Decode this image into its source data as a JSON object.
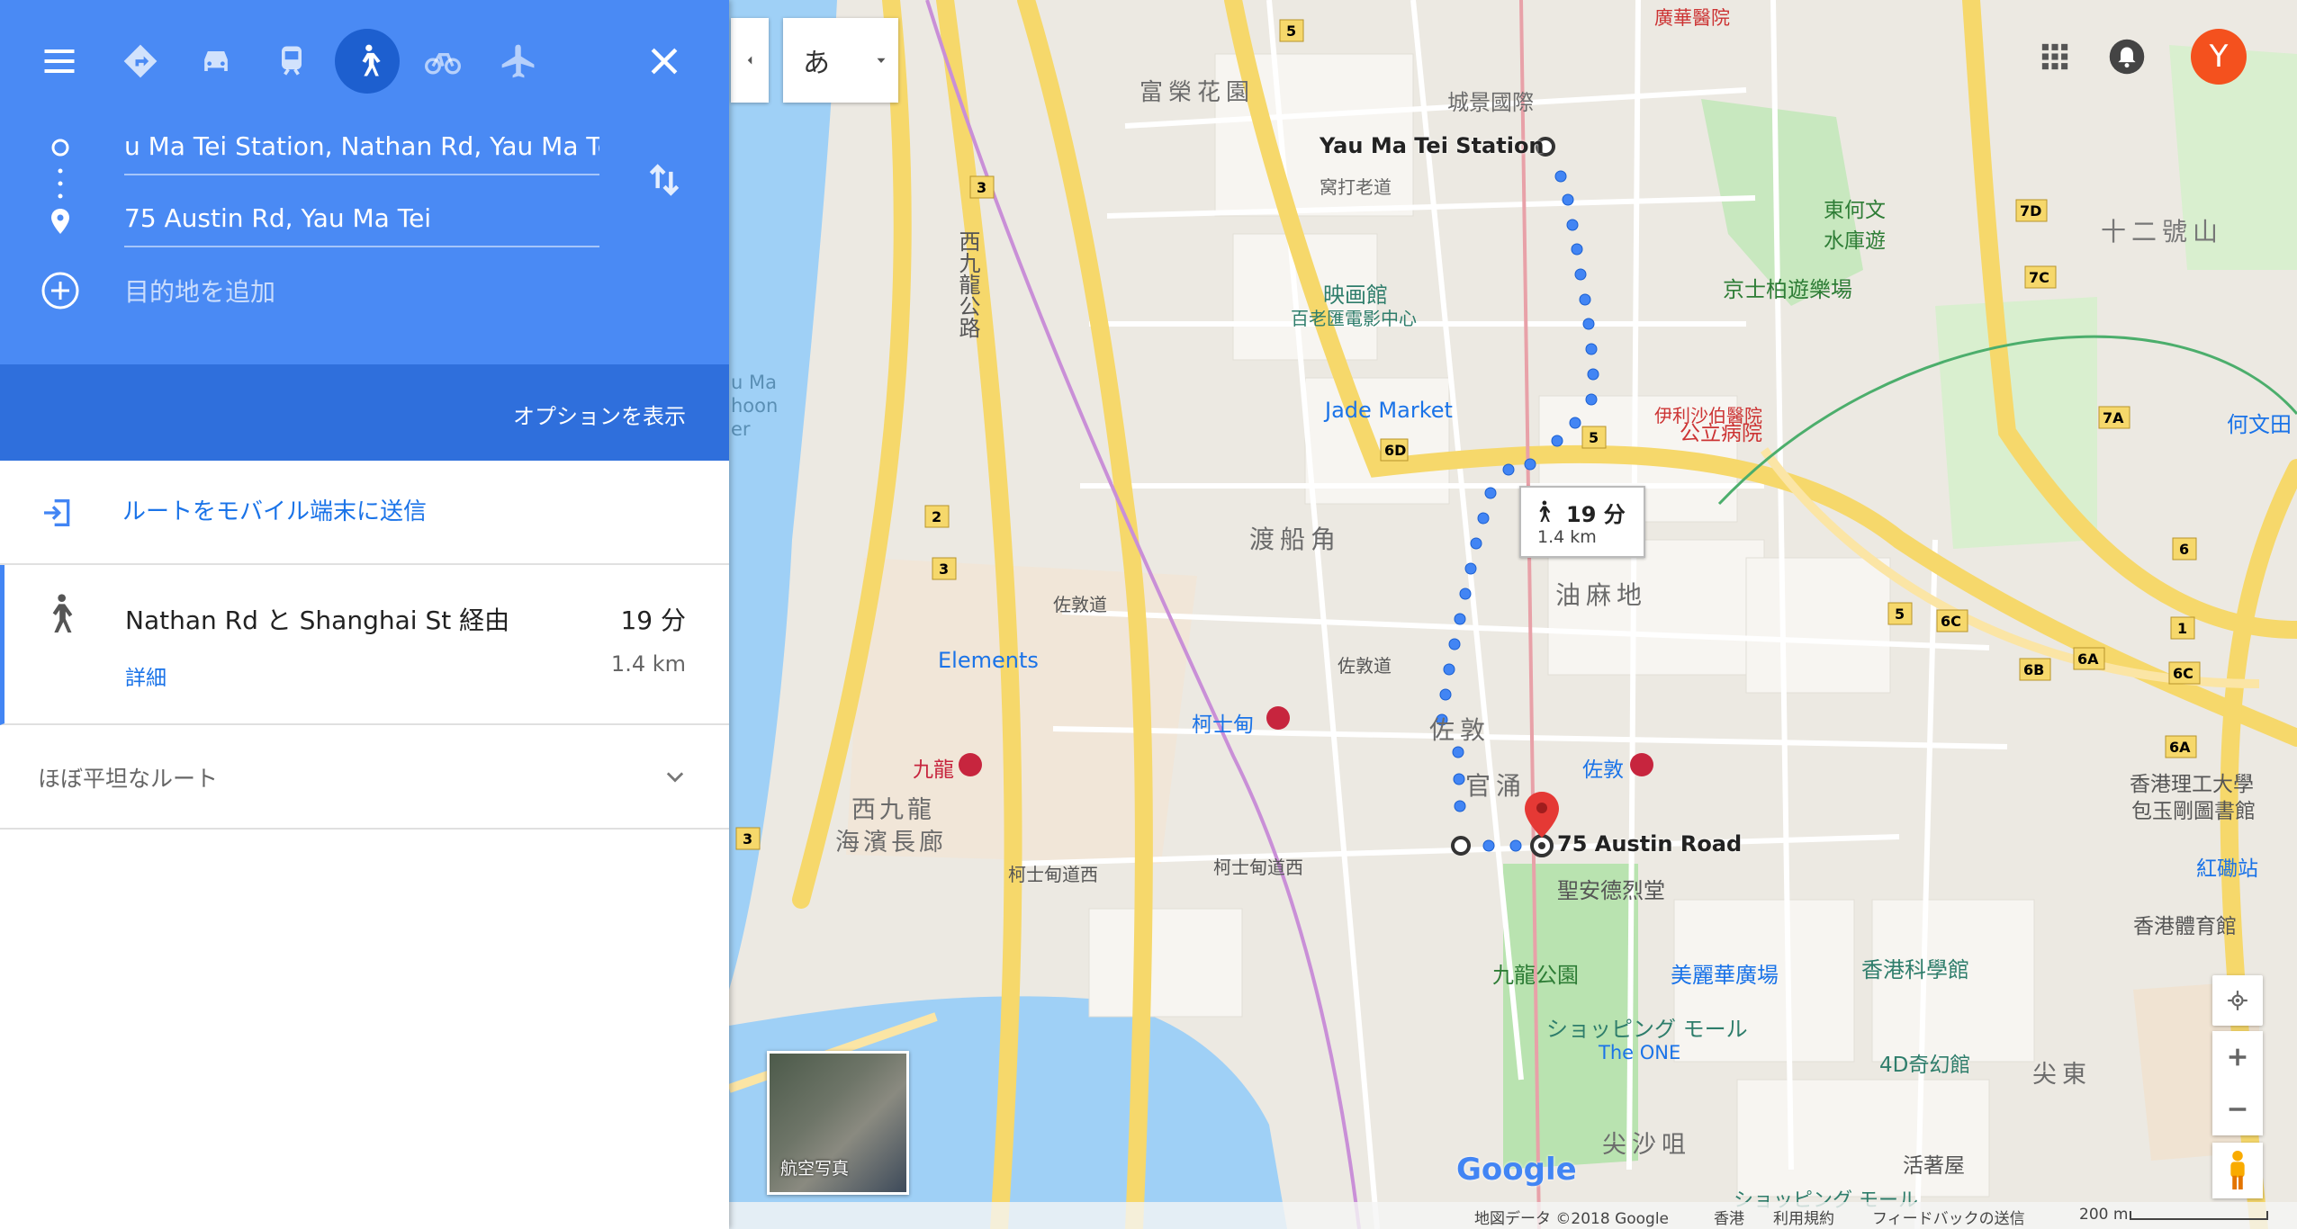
{
  "travel_modes": [
    {
      "name": "best-route",
      "icon": "directions-icon"
    },
    {
      "name": "car",
      "icon": "car-icon"
    },
    {
      "name": "transit",
      "icon": "train-icon"
    },
    {
      "name": "walk",
      "icon": "walk-icon",
      "active": true
    },
    {
      "name": "bike",
      "icon": "bike-icon"
    },
    {
      "name": "flight",
      "icon": "plane-icon"
    }
  ],
  "origin": {
    "value": "u Ma Tei Station, Nathan Rd, Yau Ma Tei"
  },
  "destination": {
    "value": "75 Austin Rd, Yau Ma Tei"
  },
  "add_destination": {
    "placeholder": "目的地を追加"
  },
  "show_options": "オプションを表示",
  "send_to_mobile": "ルートをモバイル端末に送信",
  "route": {
    "via": "Nathan Rd と Shanghai St 経由",
    "time": "19 分",
    "distance": "1.4 km",
    "details": "詳細"
  },
  "elevation": "ほぼ平坦なルート",
  "map": {
    "ime_label": "あ",
    "user_initial": "Y",
    "satellite_label": "航空写真",
    "callout": {
      "time": "19 分",
      "distance": "1.4 km"
    },
    "origin_label": "Yau Ma Tei Station",
    "destination_label": "75 Austin Road",
    "logo": "Google",
    "footer": [
      "地図データ ©2018 Google",
      "香港",
      "利用規約",
      "フィードバックの送信",
      "200 m"
    ],
    "labels": {
      "hospital_top": "廣華醫院",
      "fu_wing": "富榮花園",
      "city_view": "城景國際",
      "yau_ma_tei_road": "窝打老道",
      "cinema": "映画館",
      "cinema_name": "百老匯電影中心",
      "kings_park": "京士柏遊樂場",
      "twelve": "十二號山",
      "jade_market": "Jade Market",
      "public_hospital": "公立病院",
      "queen_elizabeth": "伊利沙伯醫院",
      "tai_kok_tsui": "渡船角",
      "yau_ma_tei": "油麻地",
      "austin_station_top": "佐敦",
      "kowloon_station": "九龍",
      "elements": "Elements",
      "west_kowloon": "西九龍",
      "west_kowloon2": "海濱長廊",
      "austin_mtr": "柯士甸",
      "jordan_mtr": "佐敦",
      "kun_chung": "官涌",
      "st_andrew": "聖安德烈堂",
      "kowloon_park": "九龍公園",
      "mira_place": "美麗華廣場",
      "shopping_mall": "ショッピング モール",
      "the_one": "The ONE",
      "science_museum": "香港科學館",
      "polyu": "香港理工大學",
      "polyu2": "包玉剛圖書館",
      "hung_hom": "紅磡站",
      "coliseum": "香港體育館",
      "tst": "尖沙咀",
      "tst_east": "尖東",
      "four_d": "4D奇幻館",
      "woolworths": "活著屋",
      "shopping_mall2": "ショッピング モール",
      "west_kowloon_hwy": "西九龍公路",
      "austin_rd_w": "柯士甸道西",
      "austin_rd_w2": "柯士甸道西",
      "jordan_rd": "佐敦道",
      "jordan_rd2": "佐敦道",
      "yau_ma_tei_shelter": "u Ma\nhoon\ner",
      "tung_ho": "東何文",
      "tung_ho2": "水庫遊",
      "ho_man_tin": "何文田"
    }
  }
}
